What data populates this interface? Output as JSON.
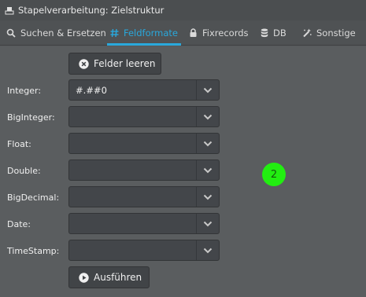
{
  "window": {
    "title": "Stapelverarbeitung: Zielstruktur"
  },
  "tabs": [
    {
      "label": "Suchen & Ersetzen",
      "icon": "search-icon"
    },
    {
      "label": "Feldformate",
      "icon": "hash-icon",
      "active": true
    },
    {
      "label": "Fixrecords",
      "icon": "lock-icon"
    },
    {
      "label": "DB",
      "icon": "database-icon"
    },
    {
      "label": "Sonstige",
      "icon": "magic-wand-icon"
    }
  ],
  "buttons": {
    "clear_label": "Felder leeren",
    "run_label": "Ausführen"
  },
  "fields": [
    {
      "label": "Integer:",
      "value": "#.##0"
    },
    {
      "label": "BigInteger:",
      "value": ""
    },
    {
      "label": "Float:",
      "value": ""
    },
    {
      "label": "Double:",
      "value": ""
    },
    {
      "label": "BigDecimal:",
      "value": ""
    },
    {
      "label": "Date:",
      "value": ""
    },
    {
      "label": "TimeStamp:",
      "value": ""
    }
  ],
  "marker": {
    "text": "2",
    "color": "#22ee11"
  },
  "colors": {
    "accent": "#29a8dc",
    "background": "#5a5d5f"
  }
}
